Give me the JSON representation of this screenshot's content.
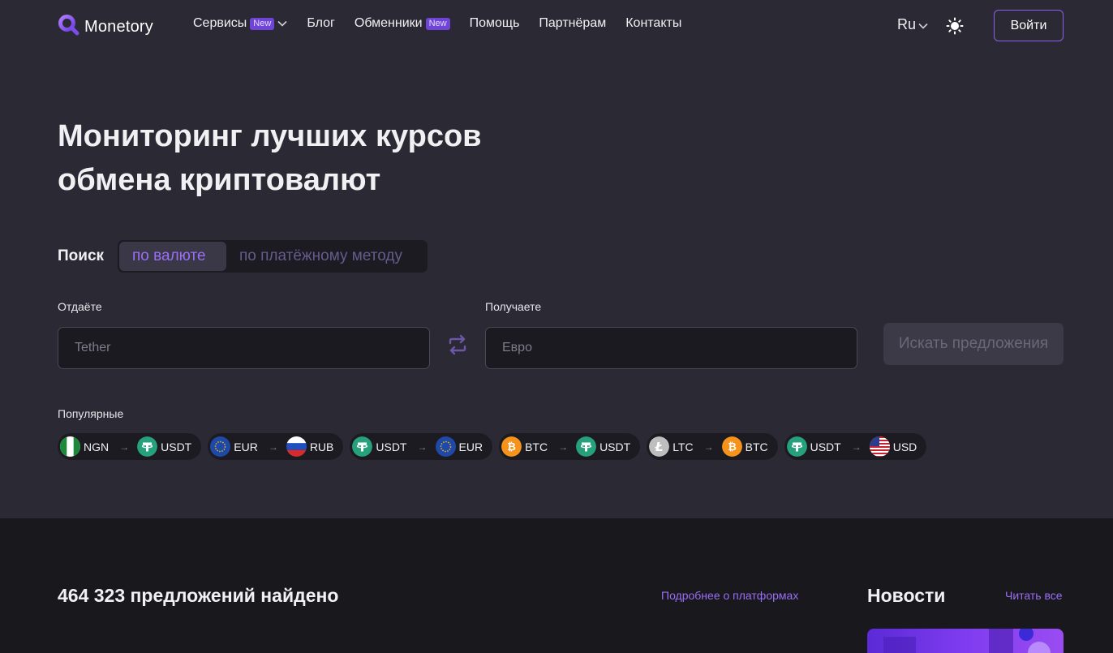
{
  "header": {
    "logo_text": "Monetory",
    "nav": [
      {
        "label": "Сервисы",
        "badge": "New"
      },
      {
        "label": "Блог"
      },
      {
        "label": "Обменники",
        "badge": "New"
      },
      {
        "label": "Помощь"
      },
      {
        "label": "Партнёрам"
      },
      {
        "label": "Контакты"
      }
    ],
    "lang": "Ru",
    "login_label": "Войти"
  },
  "hero": {
    "title_line1": "Мониторинг лучших курсов",
    "title_line2": "обмена криптовалют"
  },
  "search": {
    "label": "Поиск",
    "mode_currency": "по валюте",
    "mode_payment": "по платёжному методу",
    "give_label": "Отдаёте",
    "give_placeholder": "Tether",
    "get_label": "Получаете",
    "get_placeholder": "Евро",
    "button_label": "Искать предложения"
  },
  "popular": {
    "label": "Популярные",
    "pairs": [
      {
        "from": "NGN",
        "to": "USDT"
      },
      {
        "from": "EUR",
        "to": "RUB"
      },
      {
        "from": "USDT",
        "to": "EUR"
      },
      {
        "from": "BTC",
        "to": "USDT"
      },
      {
        "from": "LTC",
        "to": "BTC"
      },
      {
        "from": "USDT",
        "to": "USD"
      }
    ]
  },
  "offers": {
    "title": "464 323 предложений найдено",
    "platforms_link": "Подробнее о платформах"
  },
  "news": {
    "title": "Новости",
    "read_all": "Читать все"
  },
  "colors": {
    "background": "#2b2934",
    "accent": "#9a6ff5",
    "lower_background": "#19181d"
  }
}
